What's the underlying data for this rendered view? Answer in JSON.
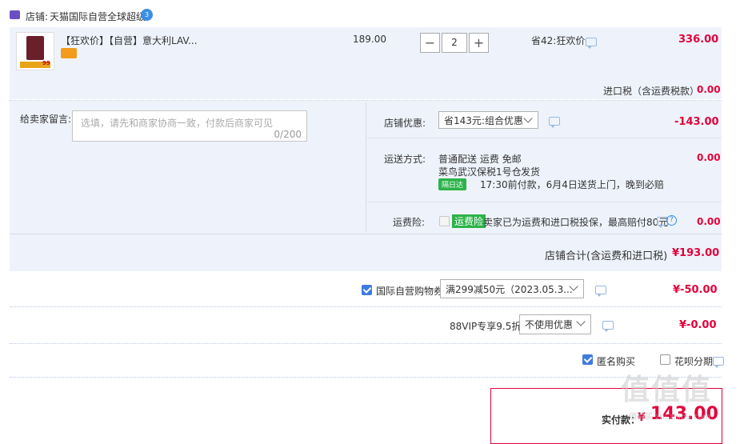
{
  "shop": {
    "prefix": "店铺:",
    "name": "天猫国际自营全球超级",
    "badge": "3"
  },
  "item": {
    "title": "【狂欢价】【自营】意大利LAV...",
    "price": "189.00",
    "qty": "2",
    "minus": "−",
    "plus": "+",
    "discount": "省42:狂欢价",
    "subtotal": "336.00",
    "thumb_tag": "99"
  },
  "tax": {
    "label": "进口税（含运费税款）",
    "value": "0.00"
  },
  "message": {
    "label": "给卖家留言:",
    "placeholder": "选填，请先和商家协商一致，付款后商家可见",
    "counter": "0/200"
  },
  "shop_discount": {
    "label": "店铺优惠:",
    "selected": "省143元:组合优惠",
    "value": "-143.00"
  },
  "shipping": {
    "label": "运送方式:",
    "method": "普通配送 运费 免邮",
    "warehouse": "菜鸟武汉保税1号仓",
    "ship_word": "发货",
    "badge": "隔日达",
    "note": "17:30前付款，6月4日送货上门，晚到必赔",
    "value": "0.00"
  },
  "insurance": {
    "label": "运费险:",
    "tag": "运费险",
    "text": "卖家已为运费和进口税投保，最高赔付80元",
    "value": "0.00"
  },
  "shop_total": {
    "label": "店铺合计(含运费和进口税)",
    "value": "¥193.00"
  },
  "coupon": {
    "label": "国际自营购物券",
    "selected": "满299减50元（2023.05.3...",
    "value": "¥-50.00"
  },
  "vip": {
    "label": "88VIP专享9.5折",
    "selected": "不使用优惠",
    "value": "¥-0.00"
  },
  "options": {
    "anonymous": "匿名购买",
    "installment": "花呗分期"
  },
  "pay": {
    "label": "实付款：",
    "currency": "¥",
    "amount": "143.00"
  },
  "watermark": "值得买 zhi.zhihu.com",
  "colors": {
    "accent_red": "#e4003a",
    "panel_bg": "#eef3fb",
    "checkbox_blue": "#3f7be0",
    "pay_border": "#e4003a"
  }
}
